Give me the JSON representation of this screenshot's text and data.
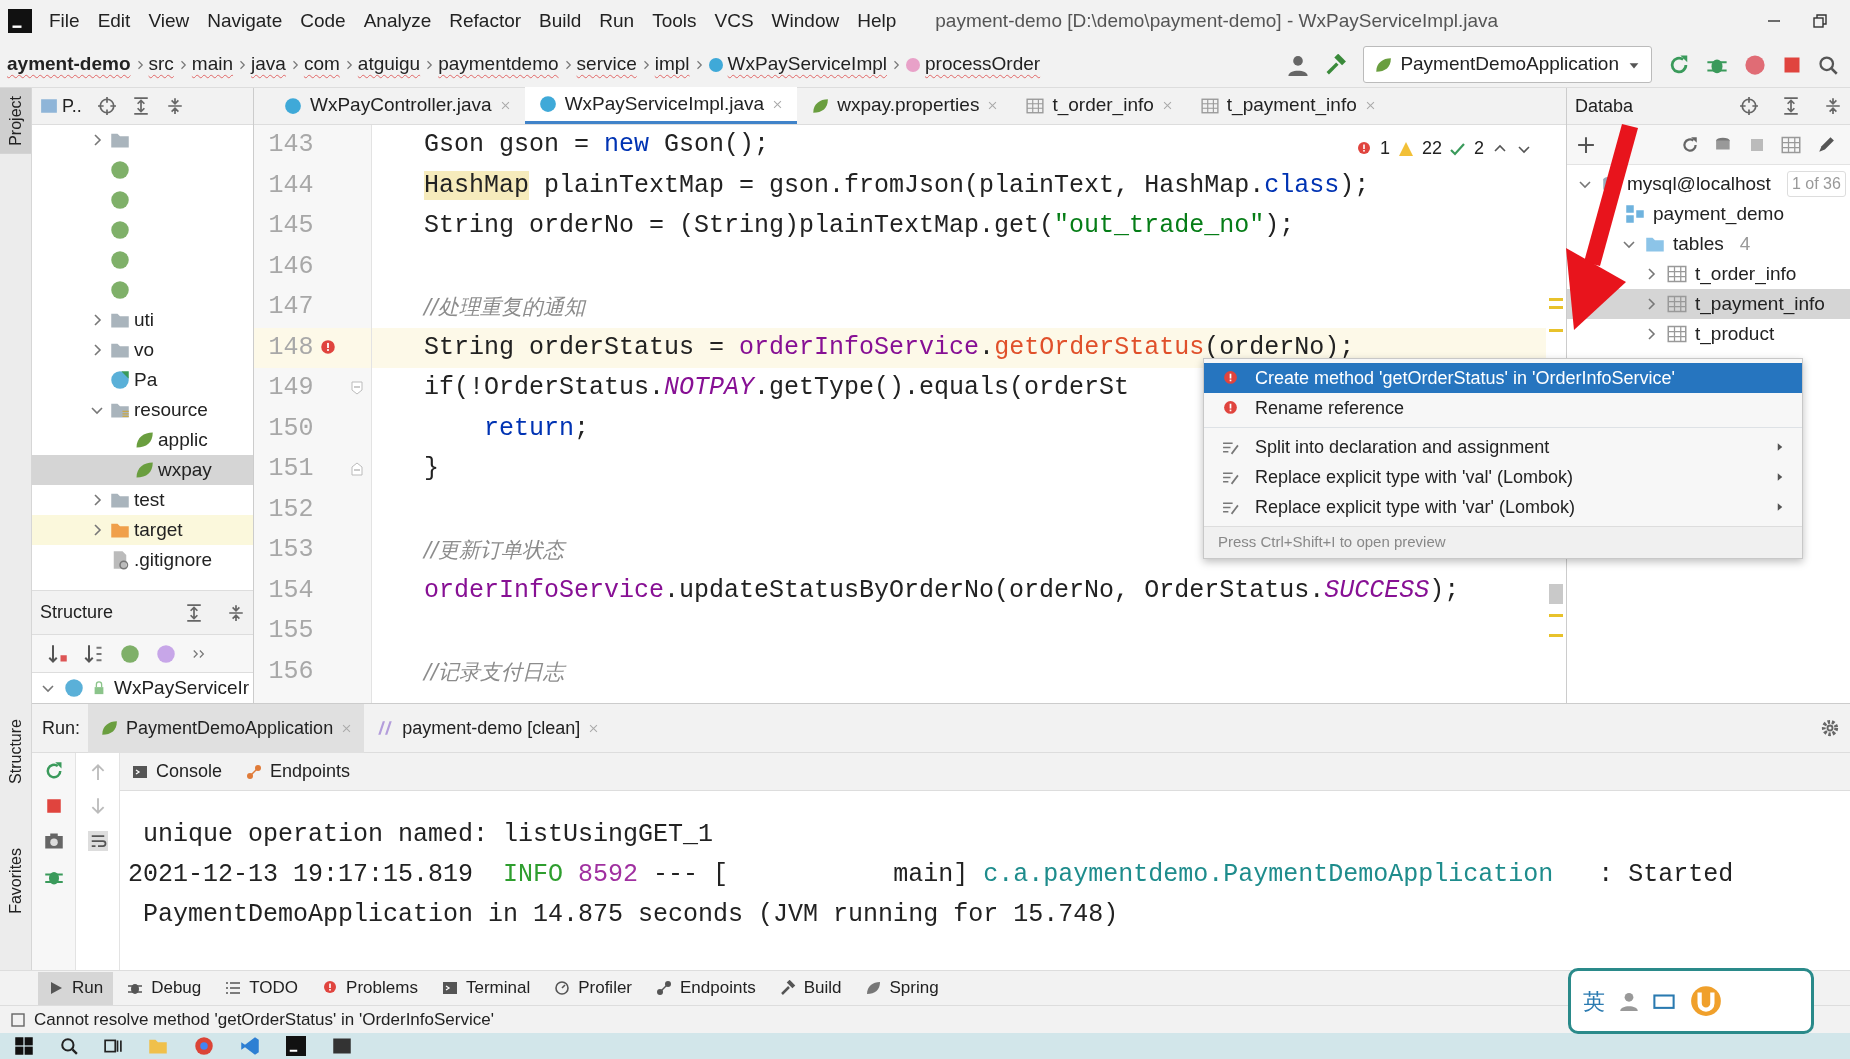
{
  "menu": [
    "File",
    "Edit",
    "View",
    "Navigate",
    "Code",
    "Analyze",
    "Refactor",
    "Build",
    "Run",
    "Tools",
    "VCS",
    "Window",
    "Help"
  ],
  "window": {
    "title": "payment-demo [D:\\demo\\payment-demo] - WxPayServiceImpl.java"
  },
  "breadcrumbs": [
    {
      "label": "ayment-demo",
      "kind": "project"
    },
    {
      "label": "src",
      "kind": "folder"
    },
    {
      "label": "main",
      "kind": "folder"
    },
    {
      "label": "java",
      "kind": "folder"
    },
    {
      "label": "com",
      "kind": "folder"
    },
    {
      "label": "atguigu",
      "kind": "folder"
    },
    {
      "label": "paymentdemo",
      "kind": "folder"
    },
    {
      "label": "service",
      "kind": "folder"
    },
    {
      "label": "impl",
      "kind": "folder"
    },
    {
      "label": "WxPayServiceImpl",
      "kind": "class"
    },
    {
      "label": "processOrder",
      "kind": "method"
    }
  ],
  "run_config": {
    "label": "PaymentDemoApplication"
  },
  "side_stripe": {
    "top": [
      {
        "label": "Project",
        "selected": true
      }
    ],
    "bottom": [
      {
        "label": "Structure",
        "selected": false
      },
      {
        "label": "Favorites",
        "selected": false
      }
    ]
  },
  "project_panel": {
    "title": "P..",
    "tree": [
      {
        "kind": "folder",
        "expanded": false,
        "selected": false
      },
      {
        "kind": "interface",
        "selected": false
      },
      {
        "kind": "interface",
        "selected": false
      },
      {
        "kind": "interface",
        "selected": false
      },
      {
        "kind": "interface",
        "selected": false
      },
      {
        "kind": "interface",
        "selected": false
      },
      {
        "label": "uti",
        "kind": "folder",
        "expanded": false,
        "selected": false
      },
      {
        "label": "vo",
        "kind": "folder",
        "expanded": false,
        "selected": false
      },
      {
        "label": "Pa",
        "kind": "spring-class",
        "selected": false
      },
      {
        "label": "resource",
        "kind": "resources",
        "expanded": true,
        "selected": false,
        "children": [
          {
            "label": "applic",
            "kind": "config",
            "selected": false
          },
          {
            "label": "wxpay",
            "kind": "config",
            "selected": true
          }
        ]
      },
      {
        "label": "test",
        "kind": "folder",
        "expanded": false,
        "selected": false
      },
      {
        "label": "target",
        "kind": "excluded",
        "expanded": false,
        "selected": false
      },
      {
        "label": ".gitignore",
        "kind": "ignore",
        "selected": false
      }
    ]
  },
  "structure_panel": {
    "title": "Structure",
    "items": [
      {
        "label": "WxPayServiceIr",
        "kind": "class",
        "expanded": true
      }
    ]
  },
  "editor_tabs": [
    {
      "label": "WxPayController.java",
      "kind": "class",
      "selected": false
    },
    {
      "label": "WxPayServiceImpl.java",
      "kind": "class",
      "selected": true
    },
    {
      "label": "wxpay.properties",
      "kind": "properties",
      "selected": false
    },
    {
      "label": "t_order_info",
      "kind": "table",
      "selected": false
    },
    {
      "label": "t_payment_info",
      "kind": "table",
      "selected": false
    }
  ],
  "editor": {
    "inspections": {
      "errors": "1",
      "warnings": "22",
      "typos": "2"
    },
    "lines": [
      {
        "number": "143",
        "current": false,
        "error_marker": false,
        "tokens": [
          {
            "text": "Gson gson = ",
            "kind": "plain"
          },
          {
            "text": "new",
            "kind": "keyword"
          },
          {
            "text": " Gson();",
            "kind": "plain"
          }
        ]
      },
      {
        "number": "144",
        "current": false,
        "error_marker": false,
        "tokens": [
          {
            "text": "HashMap",
            "kind": "highlight"
          },
          {
            "text": " plainTextMap = gson.fromJson(plainText, HashMap.",
            "kind": "plain"
          },
          {
            "text": "class",
            "kind": "keyword"
          },
          {
            "text": ");",
            "kind": "plain"
          }
        ]
      },
      {
        "number": "145",
        "current": false,
        "error_marker": false,
        "tokens": [
          {
            "text": "String orderNo = (String)plainTextMap.get(",
            "kind": "plain"
          },
          {
            "text": "\"out_trade_no\"",
            "kind": "string"
          },
          {
            "text": ");",
            "kind": "plain"
          }
        ]
      },
      {
        "number": "146",
        "current": false,
        "error_marker": false
      },
      {
        "number": "147",
        "current": false,
        "error_marker": false,
        "tokens": [
          {
            "text": "//处理重复的通知",
            "kind": "comment"
          }
        ]
      },
      {
        "number": "148",
        "current": true,
        "error_marker": true,
        "tokens": [
          {
            "text": "String orderStatus = ",
            "kind": "plain"
          },
          {
            "text": "orderInfoService",
            "kind": "field"
          },
          {
            "text": ".",
            "kind": "plain"
          },
          {
            "text": "getOrderStatus",
            "kind": "error"
          },
          {
            "text": "(orderNo);",
            "kind": "plain"
          }
        ]
      },
      {
        "number": "149",
        "current": false,
        "error_marker": false,
        "fold_start": true,
        "tokens": [
          {
            "text": "if(!OrderStatus.",
            "kind": "plain"
          },
          {
            "text": "NOTPAY",
            "kind": "static"
          },
          {
            "text": ".getType().equals(orderSt",
            "kind": "plain"
          }
        ]
      },
      {
        "number": "150",
        "current": false,
        "error_marker": false,
        "tokens": [
          {
            "text": "    return",
            "kind": "keyword"
          },
          {
            "text": ";",
            "kind": "plain"
          }
        ]
      },
      {
        "number": "151",
        "current": false,
        "error_marker": false,
        "fold_end": true,
        "tokens": [
          {
            "text": "}",
            "kind": "plain"
          }
        ]
      },
      {
        "number": "152",
        "current": false,
        "error_marker": false
      },
      {
        "number": "153",
        "current": false,
        "error_marker": false,
        "tokens": [
          {
            "text": "//更新订单状态",
            "kind": "comment"
          }
        ]
      },
      {
        "number": "154",
        "current": false,
        "error_marker": false,
        "tokens": [
          {
            "text": "orderInfoService",
            "kind": "field"
          },
          {
            "text": ".updateStatusByOrderNo(orderNo, OrderStatus.",
            "kind": "plain"
          },
          {
            "text": "SUCCESS",
            "kind": "static"
          },
          {
            "text": ");",
            "kind": "plain"
          }
        ]
      },
      {
        "number": "155",
        "current": false,
        "error_marker": false
      },
      {
        "number": "156",
        "current": false,
        "error_marker": false,
        "tokens": [
          {
            "text": "//记录支付日志",
            "kind": "comment"
          }
        ]
      }
    ]
  },
  "popup": {
    "groups": [
      [
        {
          "label": "Create method 'getOrderStatus' in 'OrderInfoService'",
          "kind": "error",
          "selected": true,
          "submenu": false
        },
        {
          "label": "Rename reference",
          "kind": "error",
          "selected": false,
          "submenu": false
        }
      ],
      [
        {
          "label": "Split into declaration and assignment",
          "kind": "intention",
          "selected": false,
          "submenu": true
        },
        {
          "label": "Replace explicit type with 'val' (Lombok)",
          "kind": "intention",
          "selected": false,
          "submenu": true
        },
        {
          "label": "Replace explicit type with 'var' (Lombok)",
          "kind": "intention",
          "selected": false,
          "submenu": true
        }
      ]
    ],
    "hint": "Press Ctrl+Shift+I to open preview"
  },
  "database_panel": {
    "title": "Databa",
    "tree": [
      {
        "label": "mysql@localhost",
        "kind": "connection",
        "badge": "1 of 36",
        "expanded": true,
        "selected": false,
        "children": [
          {
            "label": "payment_demo",
            "kind": "schema",
            "selected": false,
            "children": [
              {
                "label": "tables",
                "kind": "folder",
                "count": "4",
                "expanded": true,
                "selected": false,
                "children": [
                  {
                    "label": "t_order_info",
                    "kind": "table",
                    "expanded": false,
                    "selected": false
                  },
                  {
                    "label": "t_payment_info",
                    "kind": "table",
                    "expanded": false,
                    "selected": true
                  },
                  {
                    "label": "t_product",
                    "kind": "table",
                    "expanded": false,
                    "selected": false
                  }
                ]
              }
            ]
          }
        ]
      }
    ]
  },
  "run_panel": {
    "label": "Run:",
    "tabs": [
      {
        "label": "PaymentDemoApplication",
        "kind": "spring",
        "selected": true
      },
      {
        "label": "payment-demo [clean]",
        "kind": "maven",
        "selected": false
      }
    ],
    "subtabs": [
      {
        "label": "Console",
        "kind": "console"
      },
      {
        "label": "Endpoints",
        "kind": "endpoints"
      }
    ],
    "console": [
      [
        {
          "text": " unique operation named: listUsingGET_1",
          "kind": "plain"
        }
      ],
      [
        {
          "text": "2021-12-13 19:17:15.819  ",
          "kind": "plain"
        },
        {
          "text": "INFO",
          "kind": "info"
        },
        {
          "text": " 8592",
          "kind": "pid"
        },
        {
          "text": " --- [           main] ",
          "kind": "plain"
        },
        {
          "text": "c.a.paymentdemo.PaymentDemoApplication",
          "kind": "logger"
        },
        {
          "text": "   : Started",
          "kind": "plain"
        }
      ],
      [
        {
          "text": " PaymentDemoApplication in 14.875 seconds (JVM running for 15.748)",
          "kind": "plain"
        }
      ]
    ]
  },
  "tool_strip": [
    {
      "label": "Run",
      "kind": "run",
      "selected": true
    },
    {
      "label": "Debug",
      "kind": "debug",
      "selected": false
    },
    {
      "label": "TODO",
      "kind": "todo",
      "selected": false
    },
    {
      "label": "Problems",
      "kind": "problems",
      "selected": false
    },
    {
      "label": "Terminal",
      "kind": "terminal",
      "selected": false
    },
    {
      "label": "Profiler",
      "kind": "profiler",
      "selected": false
    },
    {
      "label": "Endpoints",
      "kind": "endpoints",
      "selected": false
    },
    {
      "label": "Build",
      "kind": "build",
      "selected": false
    },
    {
      "label": "Spring",
      "kind": "spring",
      "selected": false
    }
  ],
  "status_bar": {
    "message": "Cannot resolve method 'getOrderStatus' in 'OrderInfoService'"
  },
  "ime_toolbar": {
    "label": "英"
  }
}
